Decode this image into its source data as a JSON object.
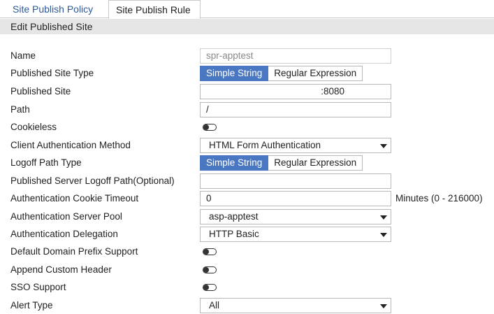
{
  "tabs": [
    {
      "label": "Site Publish Policy",
      "active": false
    },
    {
      "label": "Site Publish Rule",
      "active": true
    }
  ],
  "section_title": "Edit Published Site",
  "fields": {
    "name": {
      "label": "Name",
      "value": "spr-apptest"
    },
    "published_site_type": {
      "label": "Published Site Type",
      "options": [
        "Simple String",
        "Regular Expression"
      ],
      "selected": "Simple String"
    },
    "published_site": {
      "label": "Published Site",
      "value": ":8080"
    },
    "path": {
      "label": "Path",
      "value": "/"
    },
    "cookieless": {
      "label": "Cookieless",
      "enabled": false
    },
    "client_auth_method": {
      "label": "Client Authentication Method",
      "value": "HTML Form Authentication"
    },
    "logoff_path_type": {
      "label": "Logoff Path Type",
      "options": [
        "Simple String",
        "Regular Expression"
      ],
      "selected": "Simple String"
    },
    "logoff_path": {
      "label": "Published Server Logoff Path(Optional)",
      "value": ""
    },
    "cookie_timeout": {
      "label": "Authentication Cookie Timeout",
      "value": "0",
      "hint": "Minutes (0 - 216000)"
    },
    "auth_server_pool": {
      "label": "Authentication Server Pool",
      "value": "asp-apptest"
    },
    "auth_delegation": {
      "label": "Authentication Delegation",
      "value": "HTTP Basic"
    },
    "default_domain_prefix": {
      "label": "Default Domain Prefix Support",
      "enabled": false
    },
    "append_custom_header": {
      "label": "Append Custom Header",
      "enabled": false
    },
    "sso_support": {
      "label": "SSO Support",
      "enabled": false
    },
    "alert_type": {
      "label": "Alert Type",
      "value": "All"
    }
  },
  "colors": {
    "accent": "#4a77c1",
    "tab_link": "#2d5a9e",
    "section_bg": "#e6e6e6"
  },
  "icons": {
    "dropdown": "caret-down-icon",
    "toggle": "toggle-off-icon"
  }
}
